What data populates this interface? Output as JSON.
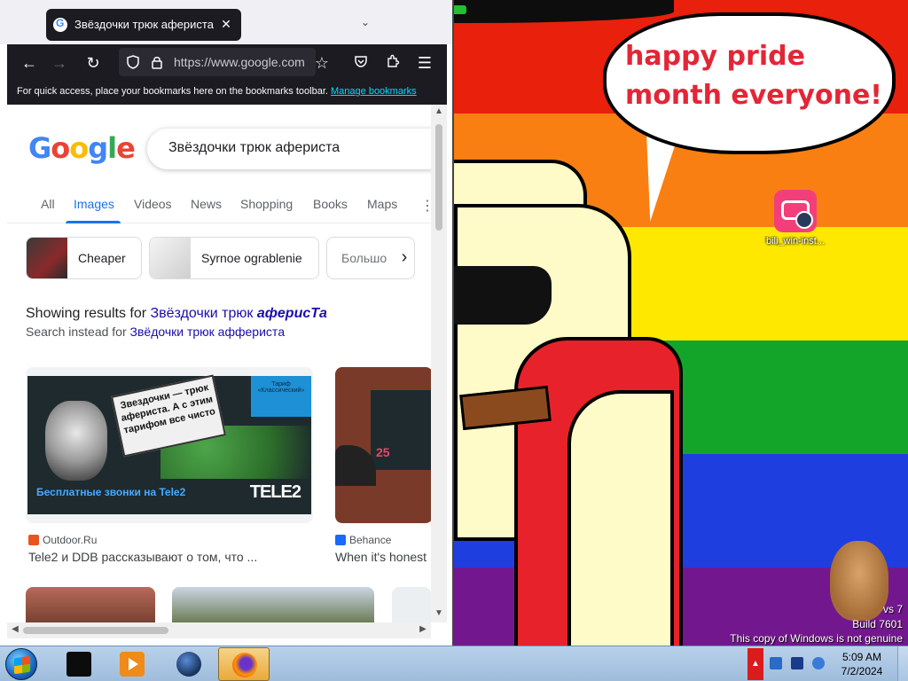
{
  "browser": {
    "tab": {
      "title": "Звёздочки трюк афериста - G"
    },
    "toolbar": {
      "url": "https://www.google.com"
    },
    "bookmarks_bar": {
      "text": "For quick access, place your bookmarks here on the bookmarks toolbar.",
      "manage_link": "Manage bookmarks"
    }
  },
  "google": {
    "query": "Звёздочки трюк афериста",
    "tabs": [
      {
        "label": "All"
      },
      {
        "label": "Images",
        "active": true
      },
      {
        "label": "Videos"
      },
      {
        "label": "News"
      },
      {
        "label": "Shopping"
      },
      {
        "label": "Books"
      },
      {
        "label": "Maps"
      }
    ],
    "chips": [
      {
        "label": "Cheaper"
      },
      {
        "label": "Syrnoe ograblenie"
      },
      {
        "label": "Большо"
      }
    ],
    "showing": {
      "prefix": "Showing results for",
      "link_plain": "Звёздочки трюк",
      "link_italic": "аферисTа"
    },
    "instead": {
      "prefix": "Search instead for",
      "link": "Звёдочки трюк афферистa"
    },
    "results": [
      {
        "source": "Outdoor.Ru",
        "title": "Tele2 и DDB рассказывают о том, что ...",
        "billboard": {
          "headline": "Звездочки — трюк афериста. А с этим тарифом все чисто",
          "corner": "Тариф «Классический»",
          "footer": "Бесплатные звонки на Tele2",
          "brand": "TELE2"
        }
      },
      {
        "source": "Behance",
        "title": "When it's honest",
        "price": "25"
      }
    ]
  },
  "desktop": {
    "speech_bubble": "happy pride month everyone!",
    "icon_label": "bili_win-inst...",
    "watermark": {
      "line1": "vs 7",
      "line2": "Build 7601",
      "line3": "This copy of Windows is not genuine"
    }
  },
  "taskbar": {
    "clock_time": "5:09 AM",
    "clock_date": "7/2/2024"
  }
}
